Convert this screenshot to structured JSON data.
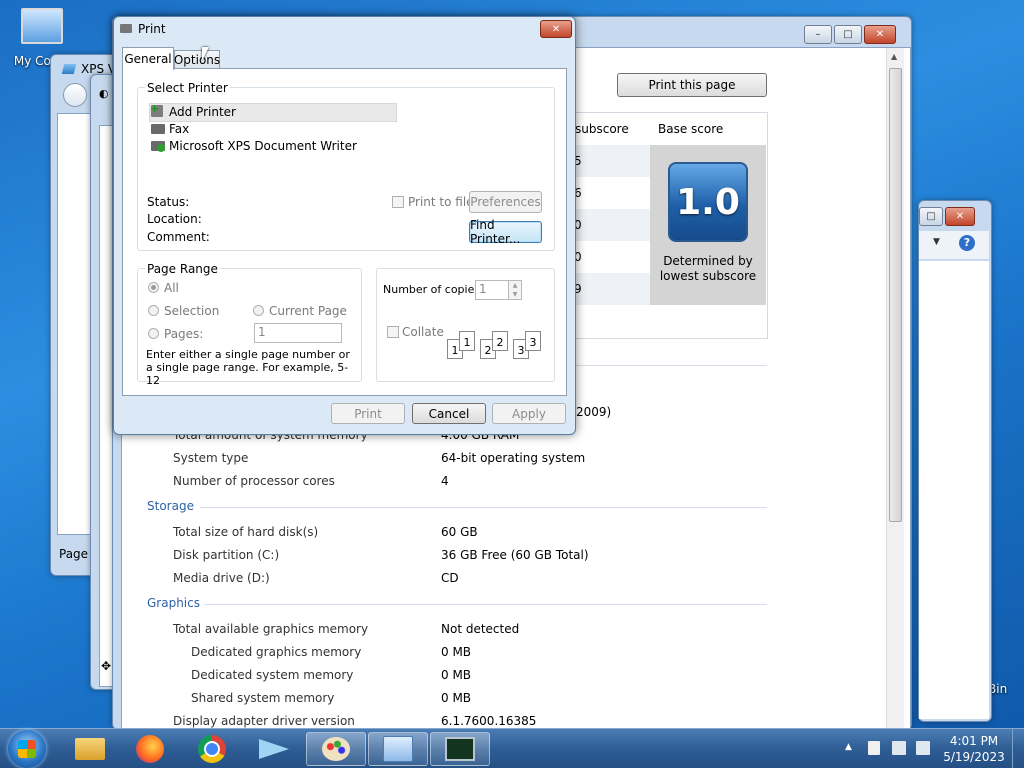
{
  "desktop": {
    "computer_label": "My Comp",
    "recycle_label": "Bin"
  },
  "xps_window": {
    "title": "XPS Vi",
    "page_label": "Page"
  },
  "system_window": {
    "print_button": "Print this page",
    "score_header": {
      "subscore": "subscore",
      "base": "Base score"
    },
    "subscores": [
      "5",
      "6",
      "0",
      "0",
      "9"
    ],
    "base_score": "1.0",
    "base_caption": "Determined by lowest subscore",
    "partial_line": "2009)",
    "system": [
      {
        "label": "Total amount of system memory",
        "value": "4.00 GB RAM"
      },
      {
        "label": "System type",
        "value": "64-bit operating system"
      },
      {
        "label": "Number of processor cores",
        "value": "4"
      }
    ],
    "storage_head": "Storage",
    "storage": [
      {
        "label": "Total size of hard disk(s)",
        "value": "60 GB"
      },
      {
        "label": "Disk partition (C:)",
        "value": "36 GB Free (60 GB Total)"
      },
      {
        "label": "Media drive (D:)",
        "value": "CD"
      }
    ],
    "graphics_head": "Graphics",
    "graphics": [
      {
        "label": "Total available graphics memory",
        "value": "Not detected"
      },
      {
        "label": "Dedicated graphics memory",
        "value": "0 MB"
      },
      {
        "label": "Dedicated system memory",
        "value": "0 MB"
      },
      {
        "label": "Shared system memory",
        "value": "0 MB"
      },
      {
        "label": "Display adapter driver version",
        "value": "6.1.7600.16385"
      }
    ]
  },
  "print_dialog": {
    "title": "Print",
    "tabs": [
      "General",
      "Options"
    ],
    "select_printer_label": "Select Printer",
    "printers": [
      "Add Printer",
      "Fax",
      "Microsoft XPS Document Writer"
    ],
    "status_label": "Status:",
    "location_label": "Location:",
    "comment_label": "Comment:",
    "print_to_file": "Print to file",
    "preferences": "Preferences",
    "find_printer": "Find Printer...",
    "page_range_label": "Page Range",
    "all": "All",
    "selection": "Selection",
    "current_page": "Current Page",
    "pages": "Pages:",
    "pages_value": "1",
    "range_hint": "Enter either a single page number or a single page range.  For example, 5-12",
    "copies_label": "Number of copies:",
    "copies_value": "1",
    "collate": "Collate",
    "collate_pages": [
      "1",
      "1",
      "2",
      "2",
      "3",
      "3"
    ],
    "print_btn": "Print",
    "cancel_btn": "Cancel",
    "apply_btn": "Apply"
  },
  "taskbar": {
    "time": "4:01 PM",
    "date": "5/19/2023"
  }
}
